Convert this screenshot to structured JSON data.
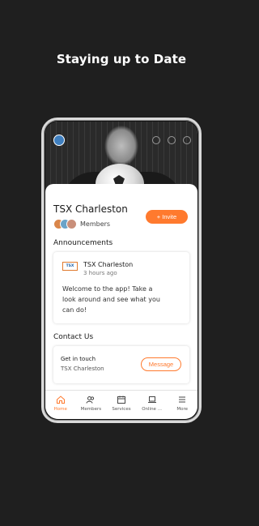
{
  "headline": "Staying up to Date",
  "team": {
    "name": "TSX Charleston",
    "members_label": "Members",
    "invite_label": "+ Invite"
  },
  "announcements": {
    "section_title": "Announcements",
    "post": {
      "logo_text": "TSX",
      "author": "TSX Charleston",
      "time": "3 hours ago",
      "body": "Welcome to the app! Take a look around and see what you can do!"
    }
  },
  "contact": {
    "section_title": "Contact Us",
    "title": "Get in touch",
    "subtitle": "TSX Charleston",
    "button_label": "Message"
  },
  "tabs": [
    {
      "label": "Home",
      "icon": "home-icon",
      "active": true
    },
    {
      "label": "Members",
      "icon": "members-icon",
      "active": false
    },
    {
      "label": "Services",
      "icon": "calendar-icon",
      "active": false
    },
    {
      "label": "Online ...",
      "icon": "laptop-icon",
      "active": false
    },
    {
      "label": "More",
      "icon": "menu-icon",
      "active": false
    }
  ],
  "colors": {
    "accent": "#ff7a2e",
    "background": "#1f1f1f"
  }
}
